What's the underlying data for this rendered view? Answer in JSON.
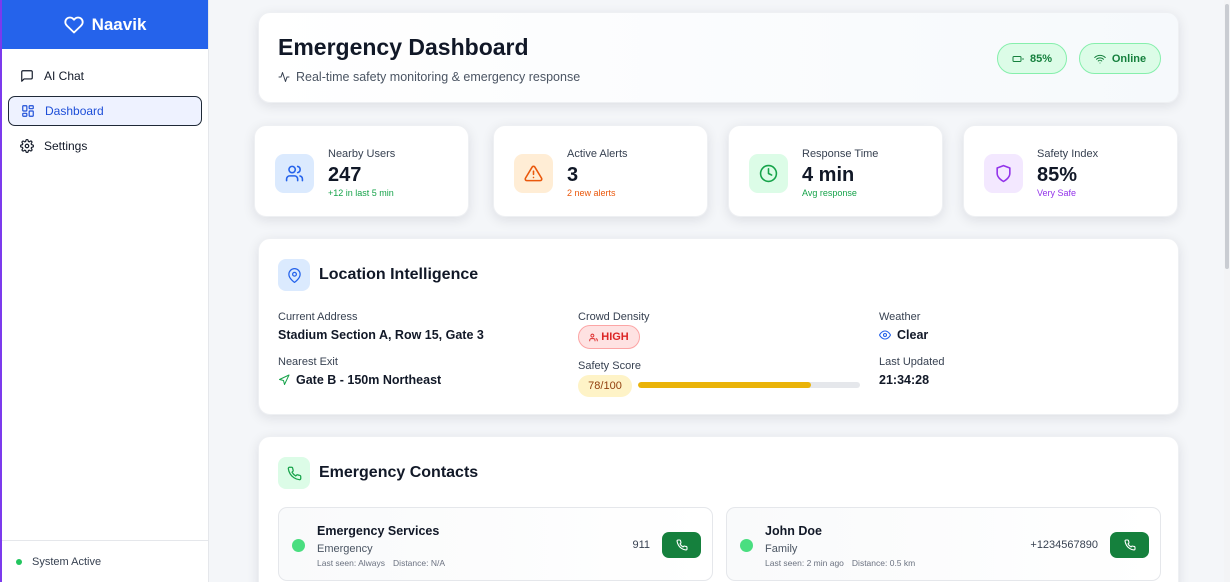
{
  "sidebar": {
    "brand": "Naavik",
    "items": [
      {
        "label": "AI Chat",
        "icon": "chat-icon"
      },
      {
        "label": "Dashboard",
        "icon": "dashboard-icon"
      },
      {
        "label": "Settings",
        "icon": "gear-icon"
      }
    ],
    "active_item": "Dashboard",
    "status": "System Active"
  },
  "header": {
    "title": "Emergency Dashboard",
    "subtitle": "Real-time safety monitoring & emergency response",
    "battery": "85%",
    "connection": "Online"
  },
  "stats": [
    {
      "label": "Nearby Users",
      "value": "247",
      "sub": "+12 in last 5 min",
      "sub_color": "#16a34a",
      "icon": "users-icon"
    },
    {
      "label": "Active Alerts",
      "value": "3",
      "sub": "2 new alerts",
      "sub_color": "#ea580c",
      "icon": "alert-triangle-icon"
    },
    {
      "label": "Response Time",
      "value": "4 min",
      "sub": "Avg response",
      "sub_color": "#16a34a",
      "icon": "clock-icon"
    },
    {
      "label": "Safety Index",
      "value": "85%",
      "sub": "Very Safe",
      "sub_color": "#9333ea",
      "icon": "shield-icon"
    }
  ],
  "location": {
    "title": "Location Intelligence",
    "current_address_label": "Current Address",
    "current_address": "Stadium Section A, Row 15, Gate 3",
    "nearest_exit_label": "Nearest Exit",
    "nearest_exit": "Gate B - 150m Northeast",
    "crowd_density_label": "Crowd Density",
    "crowd_density": "HIGH",
    "safety_score_label": "Safety Score",
    "safety_score": "78/100",
    "safety_score_fraction": 0.78,
    "weather_label": "Weather",
    "weather": "Clear",
    "last_updated_label": "Last Updated",
    "last_updated": "21:34:28"
  },
  "contacts": {
    "title": "Emergency Contacts",
    "items": [
      {
        "name": "Emergency Services",
        "type": "Emergency",
        "last_seen": "Last seen: Always",
        "distance": "Distance: N/A",
        "phone": "911"
      },
      {
        "name": "John Doe",
        "type": "Family",
        "last_seen": "Last seen: 2 min ago",
        "distance": "Distance: 0.5 km",
        "phone": "+1234567890"
      }
    ]
  },
  "colors": {
    "accent": "#2563eb",
    "online": "#16a34a",
    "danger": "#dc2626",
    "warning": "#eab308"
  }
}
